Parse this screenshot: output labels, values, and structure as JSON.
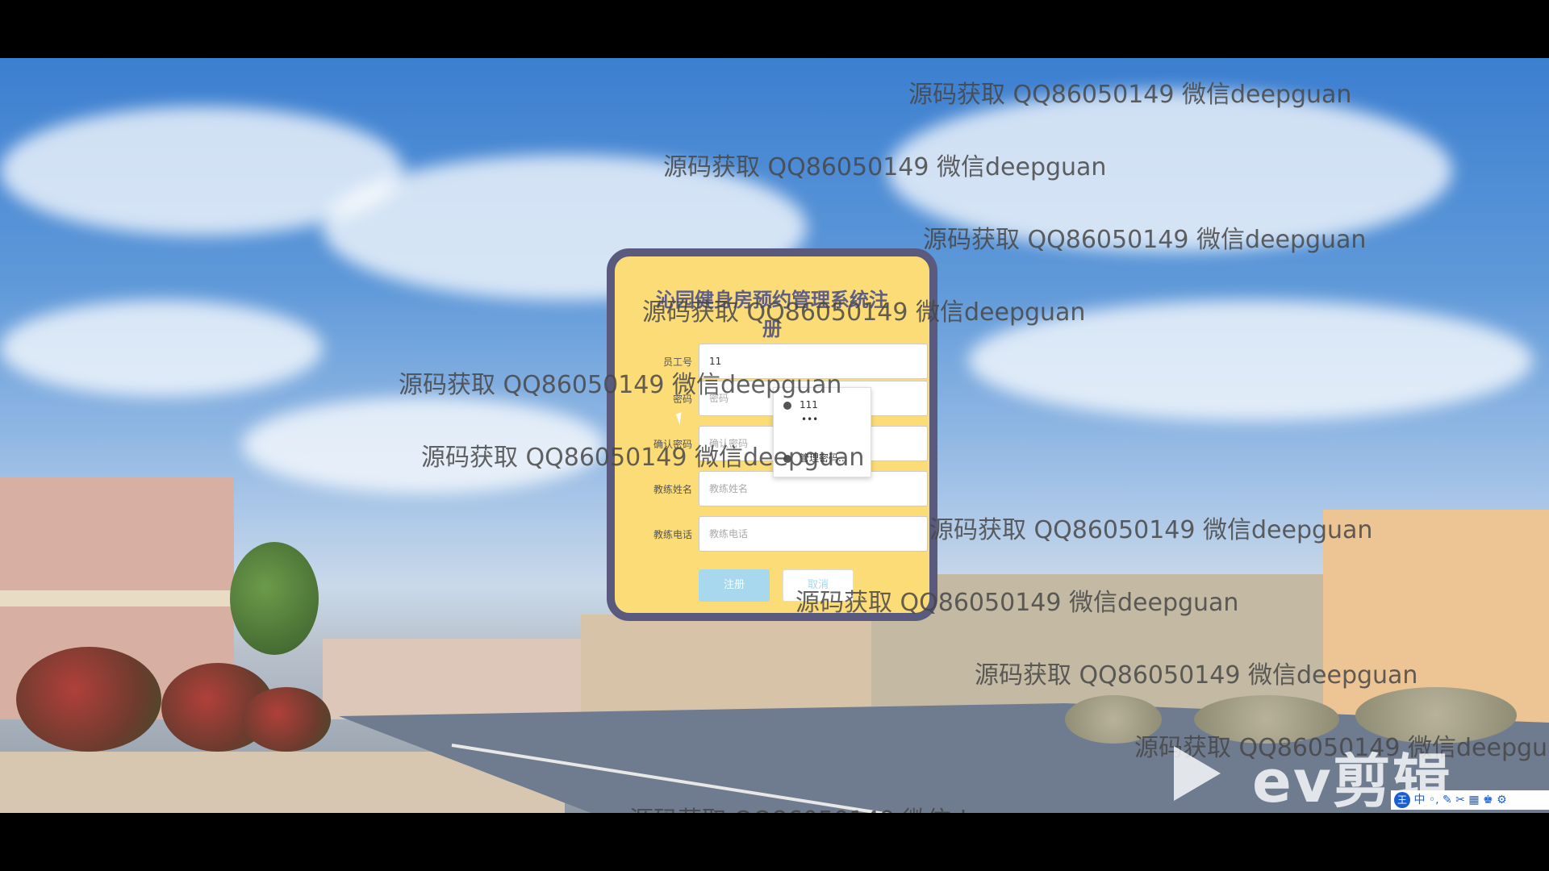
{
  "form": {
    "title": "沁园健身房预约管理系统注册",
    "fields": [
      {
        "label": "员工号",
        "value": "11",
        "placeholder": ""
      },
      {
        "label": "密码",
        "value": "",
        "placeholder": "密码"
      },
      {
        "label": "确认密码",
        "value": "",
        "placeholder": "确认密码"
      },
      {
        "label": "教练姓名",
        "value": "",
        "placeholder": "教练姓名"
      },
      {
        "label": "教练电话",
        "value": "",
        "placeholder": "教练电话"
      }
    ],
    "register_label": "注册",
    "cancel_label": "取消"
  },
  "autocomplete": {
    "items": [
      "111",
      "•••",
      "管理密码..."
    ]
  },
  "watermark": {
    "text": "源码获取 QQ86050149 微信deepguan"
  },
  "overlay": {
    "brand": "ev剪辑",
    "ime_text": "中 ◦, ✎ ✂ ▦ ♚ ⚙",
    "ime_logo": "王"
  }
}
